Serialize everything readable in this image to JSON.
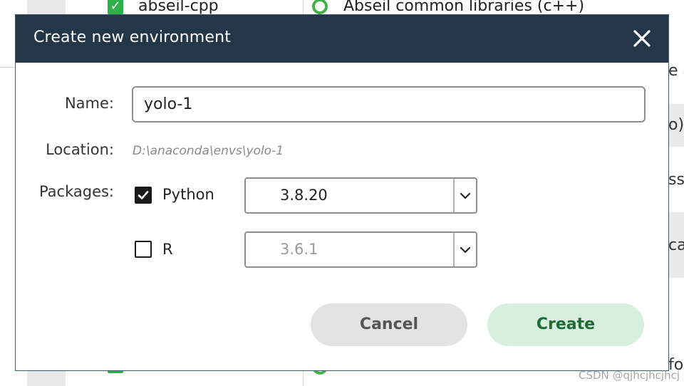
{
  "background": {
    "top_item_name": "abseil-cpp",
    "top_item_description": "Abseil common libraries (c++)",
    "edge_fragments": [
      "e a",
      "o)",
      "ss",
      "ca",
      "fo"
    ]
  },
  "dialog": {
    "title": "Create new environment",
    "name_label": "Name:",
    "name_value": "yolo-1",
    "location_label": "Location:",
    "location_value": "D:\\anaconda\\envs\\yolo-1",
    "packages_label": "Packages:",
    "packages": [
      {
        "name": "Python",
        "checked": true,
        "version": "3.8.20"
      },
      {
        "name": "R",
        "checked": false,
        "version": "3.6.1"
      }
    ],
    "cancel_label": "Cancel",
    "create_label": "Create"
  },
  "watermark": "CSDN @qjhcjhcjhcj",
  "colors": {
    "header_bg": "#243749",
    "create_bg": "#d7efdd",
    "create_text": "#1e6b35",
    "cancel_bg": "#e3e3e3",
    "check_green": "#2fb04a"
  },
  "icons": {
    "close": "close-icon",
    "check": "checkmark-icon",
    "dropdown": "chevron-down-icon"
  }
}
